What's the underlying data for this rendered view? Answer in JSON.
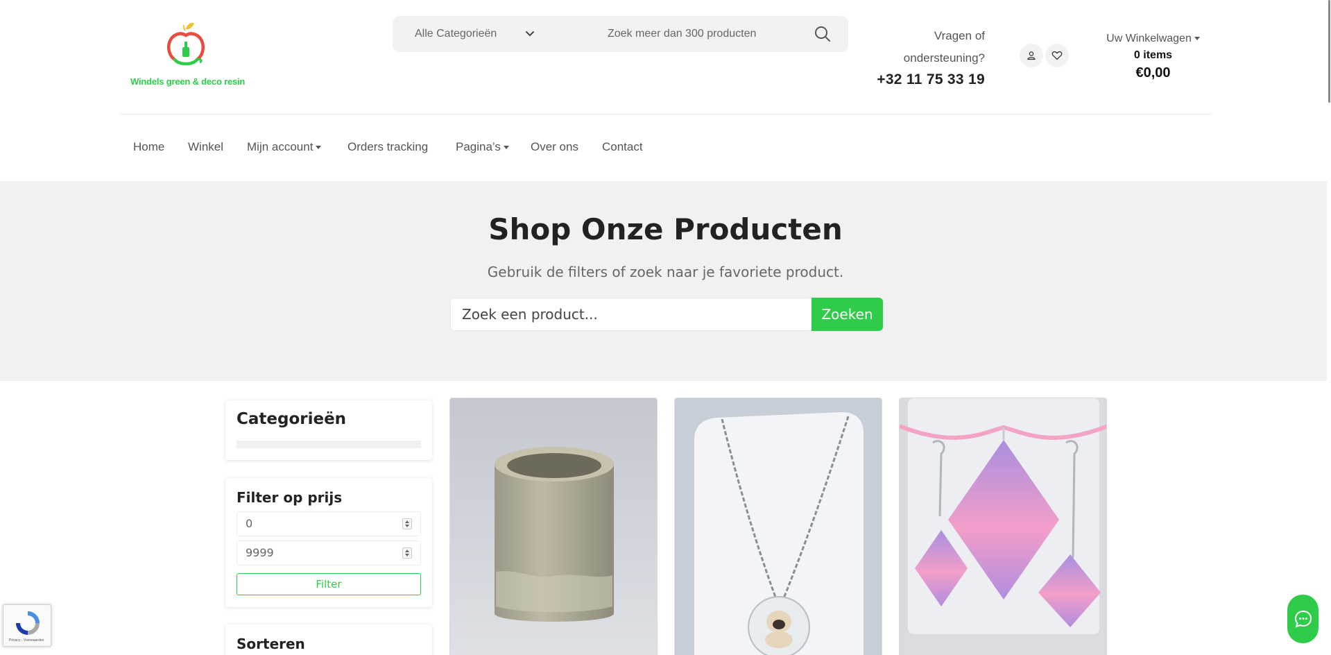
{
  "brand": {
    "name": "Windels green & deco resin",
    "accent_color": "#2ecc48"
  },
  "header": {
    "category_select": "Alle Categorieën",
    "search_placeholder": "Zoek meer dan 300 producten",
    "support_question_line1": "Vragen of",
    "support_question_line2": "ondersteuning?",
    "support_phone": "+32 11 75 33 19",
    "cart_label": "Uw Winkelwagen",
    "cart_items": "0 items",
    "cart_total": "€0,00"
  },
  "nav": {
    "items": [
      {
        "label": "Home"
      },
      {
        "label": "Winkel"
      },
      {
        "label": "Mijn account"
      },
      {
        "label": "Orders tracking"
      },
      {
        "label": "Pagina’s"
      },
      {
        "label": "Over ons"
      },
      {
        "label": "Contact"
      }
    ]
  },
  "hero": {
    "title": "Shop Onze Producten",
    "subtitle": "Gebruik de filters of zoek naar je favoriete product.",
    "search_placeholder": "Zoek een product...",
    "search_button": "Zoeken"
  },
  "sidebar": {
    "categories_title": "Categorieën",
    "price_filter_title": "Filter op prijs",
    "price_min": "0",
    "price_max": "9999",
    "filter_button": "Filter",
    "sort_title": "Sorteren"
  },
  "products": [
    {
      "image": "resin-cup-holder"
    },
    {
      "image": "pug-pendant-necklace"
    },
    {
      "image": "pink-purple-diamond-jewelry-set"
    }
  ],
  "recaptcha": {
    "text": "Privacy - Voorwaarden"
  }
}
